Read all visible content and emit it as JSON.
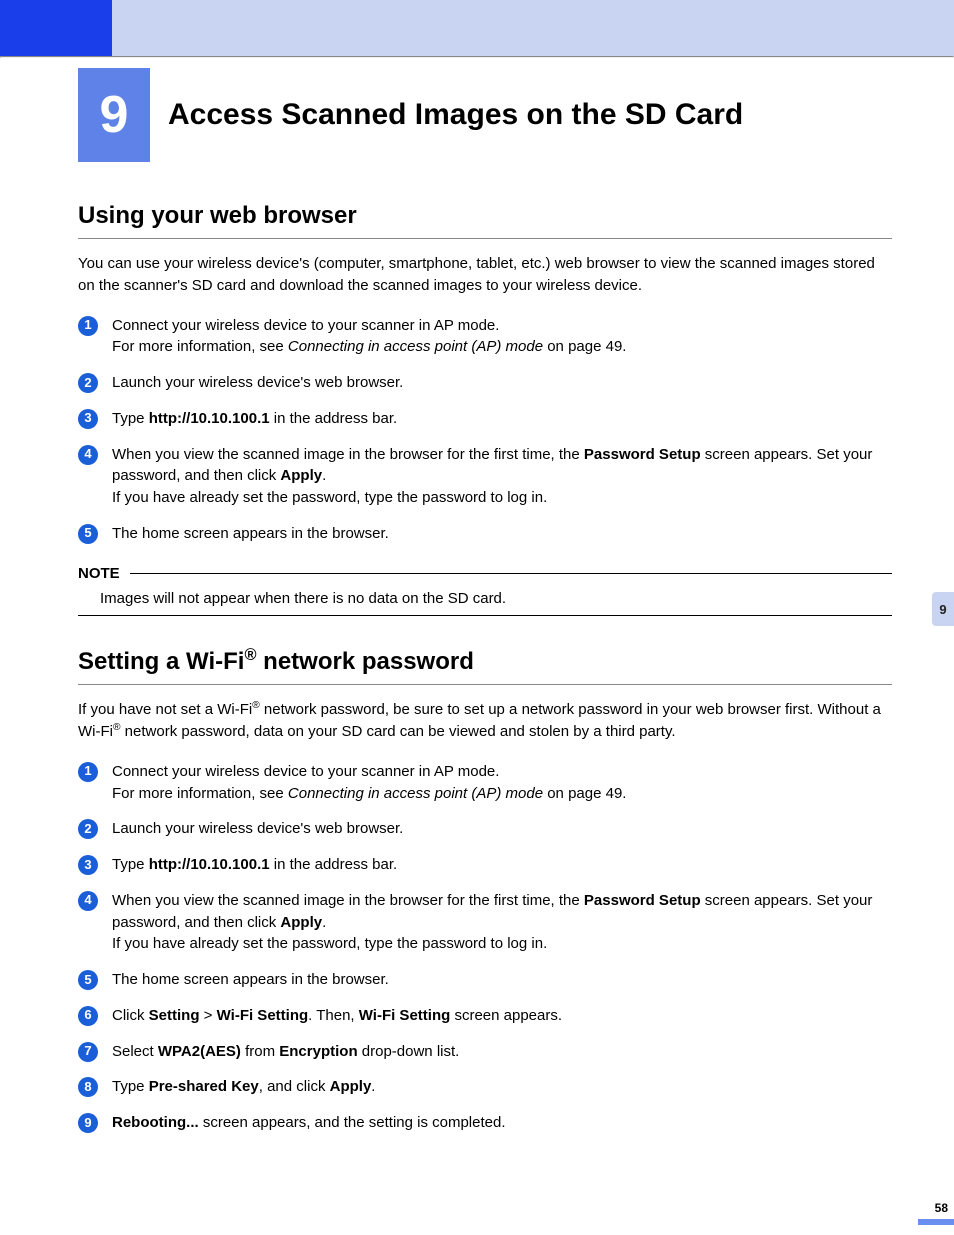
{
  "chapter": {
    "number": "9",
    "title": "Access Scanned Images on the SD Card"
  },
  "sideTab": "9",
  "pageNumber": "58",
  "section1": {
    "heading": "Using your web browser",
    "intro": "You can use your wireless device's (computer, smartphone, tablet, etc.) web browser to view the scanned images stored on the scanner's SD card and download the scanned images to your wireless device.",
    "steps": {
      "s1a": "Connect your wireless device to your scanner in AP mode.",
      "s1b_pre": "For more information, see ",
      "s1b_it": "Connecting in access point (AP) mode",
      "s1b_post": " on page 49.",
      "s2": "Launch your wireless device's web browser.",
      "s3_pre": "Type ",
      "s3_bold": "http://10.10.100.1",
      "s3_post": " in the address bar.",
      "s4a_pre": "When you view the scanned image in the browser for the first time, the ",
      "s4a_bold": "Password Setup",
      "s4a_post": " screen appears. Set your password, and then click ",
      "s4a_bold2": "Apply",
      "s4a_end": ".",
      "s4b": "If you have already set the password, type the password to log in.",
      "s5": "The home screen appears in the browser."
    },
    "note": {
      "label": "NOTE",
      "body": "Images will not appear when there is no data on the SD card."
    }
  },
  "section2": {
    "heading_pre": "Setting a Wi-Fi",
    "heading_sup": "®",
    "heading_post": " network password",
    "intro_a": "If you have not set a Wi-Fi",
    "intro_b": " network password, be sure to set up a network password in your web browser first. Without a Wi-Fi",
    "intro_c": " network password, data on your SD card can be viewed and stolen by a third party.",
    "steps": {
      "s1a": "Connect your wireless device to your scanner in AP mode.",
      "s1b_pre": "For more information, see ",
      "s1b_it": "Connecting in access point (AP) mode",
      "s1b_post": " on page 49.",
      "s2": "Launch your wireless device's web browser.",
      "s3_pre": "Type ",
      "s3_bold": "http://10.10.100.1",
      "s3_post": " in the address bar.",
      "s4a_pre": "When you view the scanned image in the browser for the first time, the ",
      "s4a_bold": "Password Setup",
      "s4a_post": " screen appears. Set your password, and then click ",
      "s4a_bold2": "Apply",
      "s4a_end": ".",
      "s4b": "If you have already set the password, type the password to log in.",
      "s5": "The home screen appears in the browser.",
      "s6_pre": "Click ",
      "s6_b1": "Setting",
      "s6_gt": " > ",
      "s6_b2": "Wi-Fi Setting",
      "s6_mid": ". Then, ",
      "s6_b3": "Wi-Fi Setting",
      "s6_post": " screen appears.",
      "s7_pre": "Select ",
      "s7_b1": "WPA2(AES)",
      "s7_mid": " from ",
      "s7_b2": "Encryption",
      "s7_post": " drop-down list.",
      "s8_pre": "Type ",
      "s8_b1": "Pre-shared Key",
      "s8_mid": ", and click ",
      "s8_b2": "Apply",
      "s8_post": ".",
      "s9_b": "Rebooting...",
      "s9_post": " screen appears, and the setting is completed."
    }
  }
}
